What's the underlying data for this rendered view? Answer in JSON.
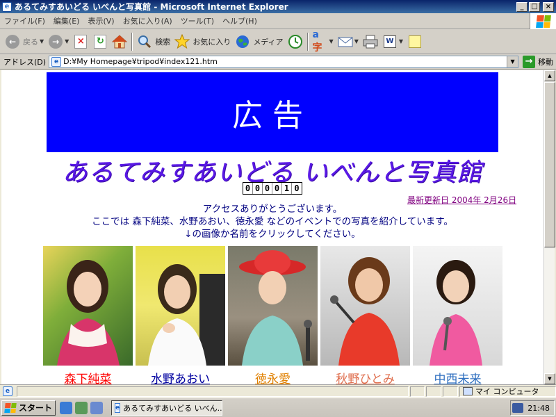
{
  "window": {
    "title": "あるてみすあいどる いべんと写真館 - Microsoft Internet Explorer",
    "minimize": "_",
    "maximize": "□",
    "close": "×"
  },
  "menu": [
    "ファイル(F)",
    "編集(E)",
    "表示(V)",
    "お気に入り(A)",
    "ツール(T)",
    "ヘルプ(H)"
  ],
  "toolbar": {
    "back_label": "戻る",
    "search_label": "検索",
    "favorites_label": "お気に入り",
    "media_label": "メディア"
  },
  "address": {
    "label": "アドレス(D)",
    "url": "D:¥My Homepage¥tripod¥index121.htm",
    "go_label": "移動"
  },
  "page": {
    "ad_text": "広告",
    "site_title": "あるてみすあいどる いべんと写真館",
    "counter": [
      "0",
      "0",
      "0",
      "0",
      "1",
      "0"
    ],
    "updated": "最新更新日 2004年 2月26日",
    "intro_lines": [
      "アクセスありがとうございます。",
      "ここでは 森下純菜、水野あおい、徳永愛 などのイベントでの写真を紹介しています。",
      "↓の画像か名前をクリックしてください。"
    ],
    "members": [
      {
        "name": "森下純菜",
        "color": "#FF0000"
      },
      {
        "name": "水野あおい",
        "color": "#0000A0"
      },
      {
        "name": "徳永愛",
        "color": "#E08000"
      },
      {
        "name": "秋野ひとみ",
        "color": "#E07050"
      },
      {
        "name": "中西未来",
        "color": "#3070C0"
      }
    ]
  },
  "status": {
    "zone": "マイ コンピュータ"
  },
  "taskbar": {
    "start": "スタート",
    "task": "あるてみすあいどる いべん...",
    "clock": "21:48"
  }
}
